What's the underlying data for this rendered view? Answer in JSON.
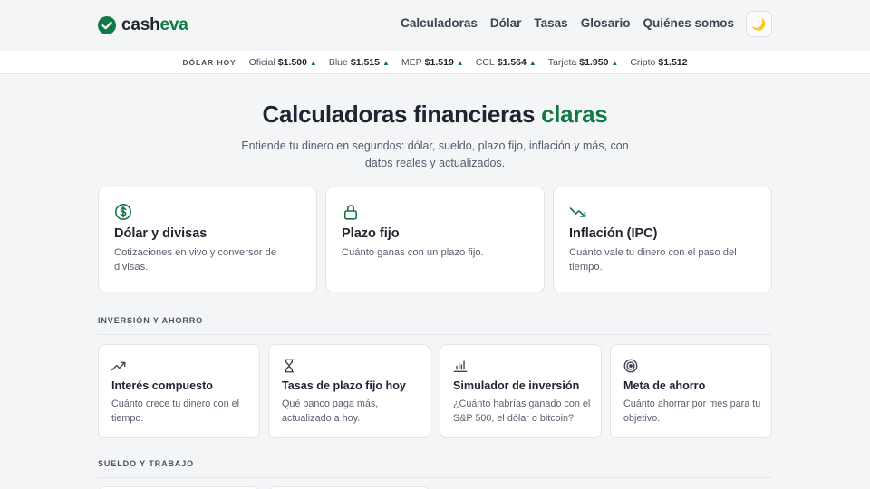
{
  "brand": {
    "name_part1": "cash",
    "name_part2": "eva"
  },
  "nav": {
    "items": [
      "Calculadoras",
      "Dólar",
      "Tasas",
      "Glosario",
      "Quiénes somos"
    ],
    "theme_icon": "🌙"
  },
  "ticker": {
    "title": "DÓLAR HOY",
    "items": [
      {
        "label": "Oficial",
        "value": "$1.500",
        "trend": "▲"
      },
      {
        "label": "Blue",
        "value": "$1.515",
        "trend": "▲"
      },
      {
        "label": "MEP",
        "value": "$1.519",
        "trend": "▲"
      },
      {
        "label": "CCL",
        "value": "$1.564",
        "trend": "▲"
      },
      {
        "label": "Tarjeta",
        "value": "$1.950",
        "trend": "▲"
      },
      {
        "label": "Cripto",
        "value": "$1.512",
        "trend": ""
      }
    ]
  },
  "hero": {
    "title_main": "Calculadoras financieras",
    "title_accent": "claras",
    "subtitle": "Entiende tu dinero en segundos: dólar, sueldo, plazo fijo, inflación y más, con datos reales y actualizados."
  },
  "featured": [
    {
      "icon": "dollar-circle-icon",
      "title": "Dólar y divisas",
      "desc": "Cotizaciones en vivo y conversor de divisas."
    },
    {
      "icon": "lock-icon",
      "title": "Plazo fijo",
      "desc": "Cuánto ganas con un plazo fijo."
    },
    {
      "icon": "trend-down-icon",
      "title": "Inflación (IPC)",
      "desc": "Cuánto vale tu dinero con el paso del tiempo."
    }
  ],
  "sections": [
    {
      "label": "INVERSIÓN Y AHORRO",
      "cards": [
        {
          "icon": "trend-up-icon",
          "title": "Interés compuesto",
          "desc": "Cuánto crece tu dinero con el tiempo."
        },
        {
          "icon": "hourglass-icon",
          "title": "Tasas de plazo fijo hoy",
          "desc": "Qué banco paga más, actualizado a hoy."
        },
        {
          "icon": "bar-chart-icon",
          "title": "Simulador de inversión",
          "desc": "¿Cuánto habrías ganado con el S&P 500, el dólar o bitcoin?"
        },
        {
          "icon": "target-icon",
          "title": "Meta de ahorro",
          "desc": "Cuánto ahorrar por mes para tu objetivo."
        }
      ]
    },
    {
      "label": "SUELDO Y TRABAJO",
      "cards": []
    }
  ],
  "colors": {
    "accent": "#0f7a45",
    "background": "#f4f5f7",
    "card": "#ffffff"
  }
}
